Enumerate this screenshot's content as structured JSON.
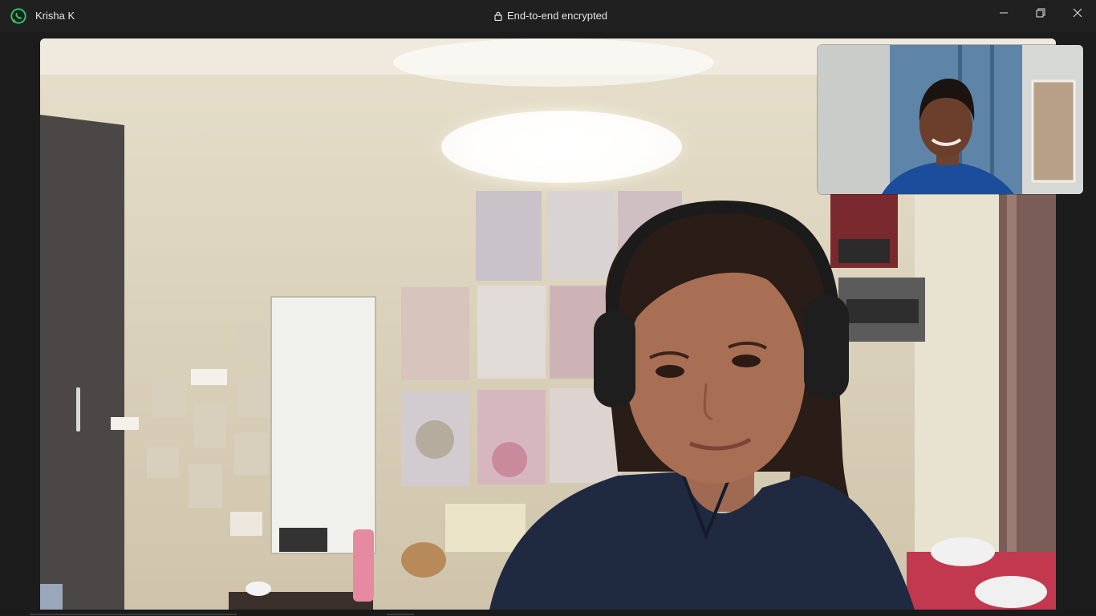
{
  "titlebar": {
    "contact_name": "Krisha K",
    "encryption_label": "End-to-end encrypted"
  },
  "icons": {
    "app_logo": "whatsapp-logo-icon",
    "lock": "lock-icon",
    "minimize": "minimize-icon",
    "restore": "restore-icon",
    "close": "close-icon"
  },
  "colors": {
    "titlebar_bg": "#202020",
    "window_bg": "#1c1c1c",
    "brand_green": "#25d366",
    "text": "#e6e6e6"
  },
  "call": {
    "remote_video": "remote-participant-video",
    "self_video": "self-preview-video"
  }
}
